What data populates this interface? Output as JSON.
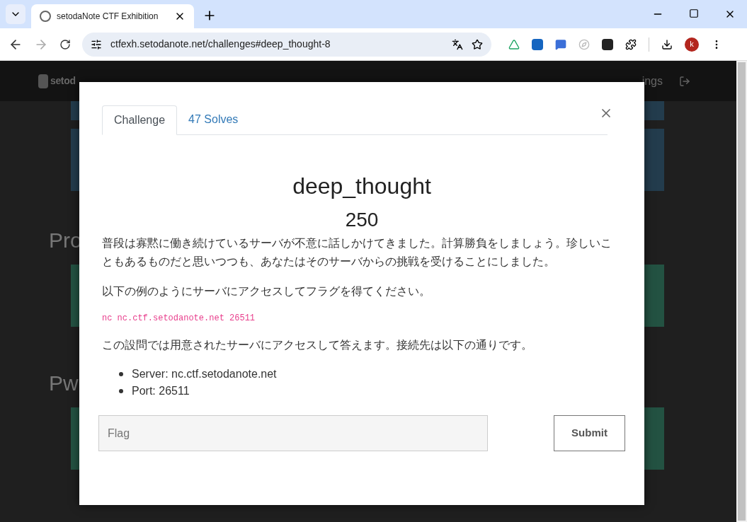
{
  "browser": {
    "tab_title": "setodaNote CTF Exhibition",
    "url": "ctfexh.setodanote.net/challenges#deep_thought-8",
    "profile": "k"
  },
  "page": {
    "brand": "setod",
    "nav_right_fragment": "ings",
    "section_headings": [
      "Pro",
      "Pw"
    ]
  },
  "modal": {
    "tabs": [
      {
        "label": "Challenge",
        "selected": true
      },
      {
        "label": "47 Solves",
        "selected": false
      }
    ],
    "title": "deep_thought",
    "value": "250",
    "description": [
      {
        "kind": "paragraph",
        "text": "普段は寡黙に働き続けているサーバが不意に話しかけてきました。計算勝負をしましょう。珍しいこともあるものだと思いつつも、あなたはそのサーバからの挑戦を受けることにしました。"
      },
      {
        "kind": "paragraph",
        "text": "以下の例のようにサーバにアクセスしてフラグを得てください。"
      },
      {
        "kind": "code",
        "text": "nc nc.ctf.setodanote.net 26511"
      },
      {
        "kind": "paragraph",
        "text": "この設問では用意されたサーバにアクセスして答えます。接続先は以下の通りです。"
      },
      {
        "kind": "list",
        "items": [
          "Server: nc.ctf.setodanote.net",
          "Port: 26511"
        ]
      }
    ],
    "flag_placeholder": "Flag",
    "submit": "Submit"
  }
}
